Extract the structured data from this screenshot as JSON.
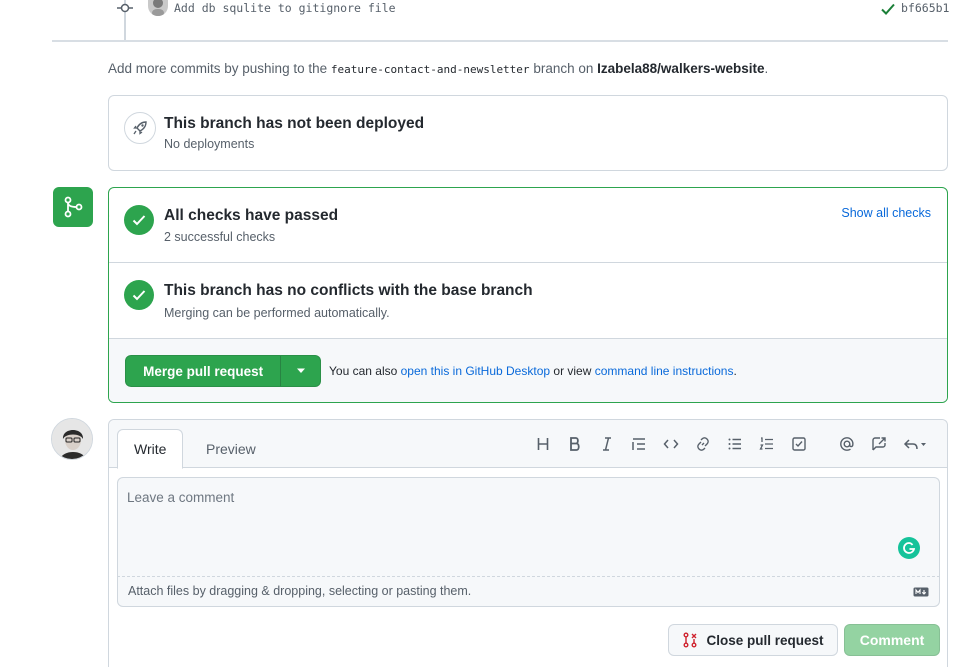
{
  "commit": {
    "message": "Add db squlite to gitignore file",
    "sha": "bf665b1"
  },
  "add_commits": {
    "prefix": "Add more commits by pushing to the",
    "branch": "feature-contact-and-newsletter",
    "middle": "branch on",
    "repo": "Izabela88/walkers-website",
    "suffix": "."
  },
  "deploy": {
    "title": "This branch has not been deployed",
    "subtitle": "No deployments"
  },
  "checks": {
    "title": "All checks have passed",
    "subtitle": "2 successful checks",
    "show_all": "Show all checks"
  },
  "conflicts": {
    "title": "This branch has no conflicts with the base branch",
    "subtitle": "Merging can be performed automatically."
  },
  "merge": {
    "button": "Merge pull request",
    "note_prefix": "You can also",
    "desktop_link": "open this in GitHub Desktop",
    "note_middle": "or view",
    "cli_link": "command line instructions",
    "note_suffix": "."
  },
  "comment": {
    "tab_write": "Write",
    "tab_preview": "Preview",
    "placeholder": "Leave a comment",
    "attach_text": "Attach files by dragging & dropping, selecting or pasting them.",
    "close_button": "Close pull request",
    "comment_button": "Comment"
  },
  "colors": {
    "success": "#2da44e",
    "link": "#0969da",
    "danger": "#cf222e",
    "comment_button_disabled": "#94d3a2"
  },
  "icons": {
    "toolbar": [
      "heading-icon",
      "bold-icon",
      "italic-icon",
      "quote-icon",
      "code-icon",
      "link-icon",
      "bulleted-list-icon",
      "numbered-list-icon",
      "task-list-icon",
      "mention-icon",
      "reference-icon",
      "reply-icon"
    ]
  }
}
